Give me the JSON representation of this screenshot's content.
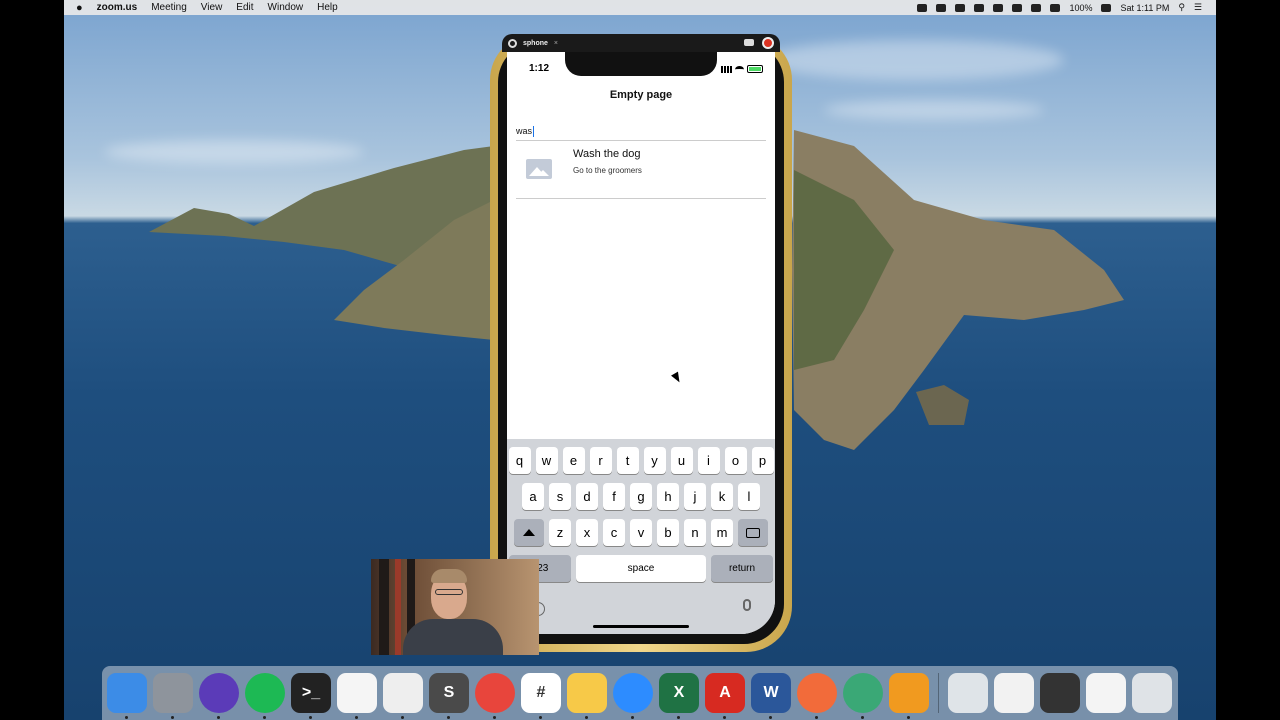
{
  "menubar": {
    "app_name": "zoom.us",
    "items": [
      "Meeting",
      "View",
      "Edit",
      "Window",
      "Help"
    ],
    "battery": "100%",
    "clock": "Sat 1:11 PM"
  },
  "simulator": {
    "tab_label": "sphone",
    "close": "×"
  },
  "phone": {
    "status_time": "1:12",
    "nav_title": "Empty page",
    "search_value": "was",
    "result": {
      "title": "Wash the dog",
      "subtitle": "Go to the groomers"
    },
    "keyboard": {
      "row1": [
        "q",
        "w",
        "e",
        "r",
        "t",
        "y",
        "u",
        "i",
        "o",
        "p"
      ],
      "row2": [
        "a",
        "s",
        "d",
        "f",
        "g",
        "h",
        "j",
        "k",
        "l"
      ],
      "row3": [
        "z",
        "x",
        "c",
        "v",
        "b",
        "n",
        "m"
      ],
      "num_label": "123",
      "space_label": "space",
      "return_label": "return"
    }
  },
  "dock": {
    "apps": [
      {
        "name": "finder-icon",
        "color": "#3c8ce7",
        "glyph": ""
      },
      {
        "name": "launchpad-icon",
        "color": "#8e949c",
        "glyph": ""
      },
      {
        "name": "siri-icon",
        "color": "#5b3bb8",
        "glyph": ""
      },
      {
        "name": "spotify-icon",
        "color": "#1db954",
        "glyph": ""
      },
      {
        "name": "terminal-icon",
        "color": "#222222",
        "glyph": ">_"
      },
      {
        "name": "reminders-icon",
        "color": "#f5f5f5",
        "glyph": ""
      },
      {
        "name": "textedit-icon",
        "color": "#eeeeee",
        "glyph": ""
      },
      {
        "name": "sublime-text-icon",
        "color": "#4a4a4a",
        "glyph": "S"
      },
      {
        "name": "chrome-icon",
        "color": "#e8453c",
        "glyph": ""
      },
      {
        "name": "slack-icon",
        "color": "#ffffff",
        "glyph": "#"
      },
      {
        "name": "idea-bulb-icon",
        "color": "#f7c948",
        "glyph": ""
      },
      {
        "name": "zoom-icon",
        "color": "#2d8cff",
        "glyph": ""
      },
      {
        "name": "excel-icon",
        "color": "#1f7244",
        "glyph": "X"
      },
      {
        "name": "acrobat-icon",
        "color": "#d72a21",
        "glyph": "A"
      },
      {
        "name": "word-icon",
        "color": "#2b579a",
        "glyph": "W"
      },
      {
        "name": "paw-icon",
        "color": "#f26b3a",
        "glyph": ""
      },
      {
        "name": "vpn-icon",
        "color": "#3aa876",
        "glyph": ""
      },
      {
        "name": "frames-icon",
        "color": "#f19a1f",
        "glyph": ""
      }
    ],
    "right": [
      {
        "name": "downloads-stack-icon",
        "color": "#dfe4e8"
      },
      {
        "name": "screenshot-stack-icon",
        "color": "#f2f2f2"
      },
      {
        "name": "video-stack-icon",
        "color": "#333333"
      },
      {
        "name": "document-stack-icon",
        "color": "#f4f4f4"
      },
      {
        "name": "trash-icon",
        "color": "#dfe3e7"
      }
    ]
  }
}
